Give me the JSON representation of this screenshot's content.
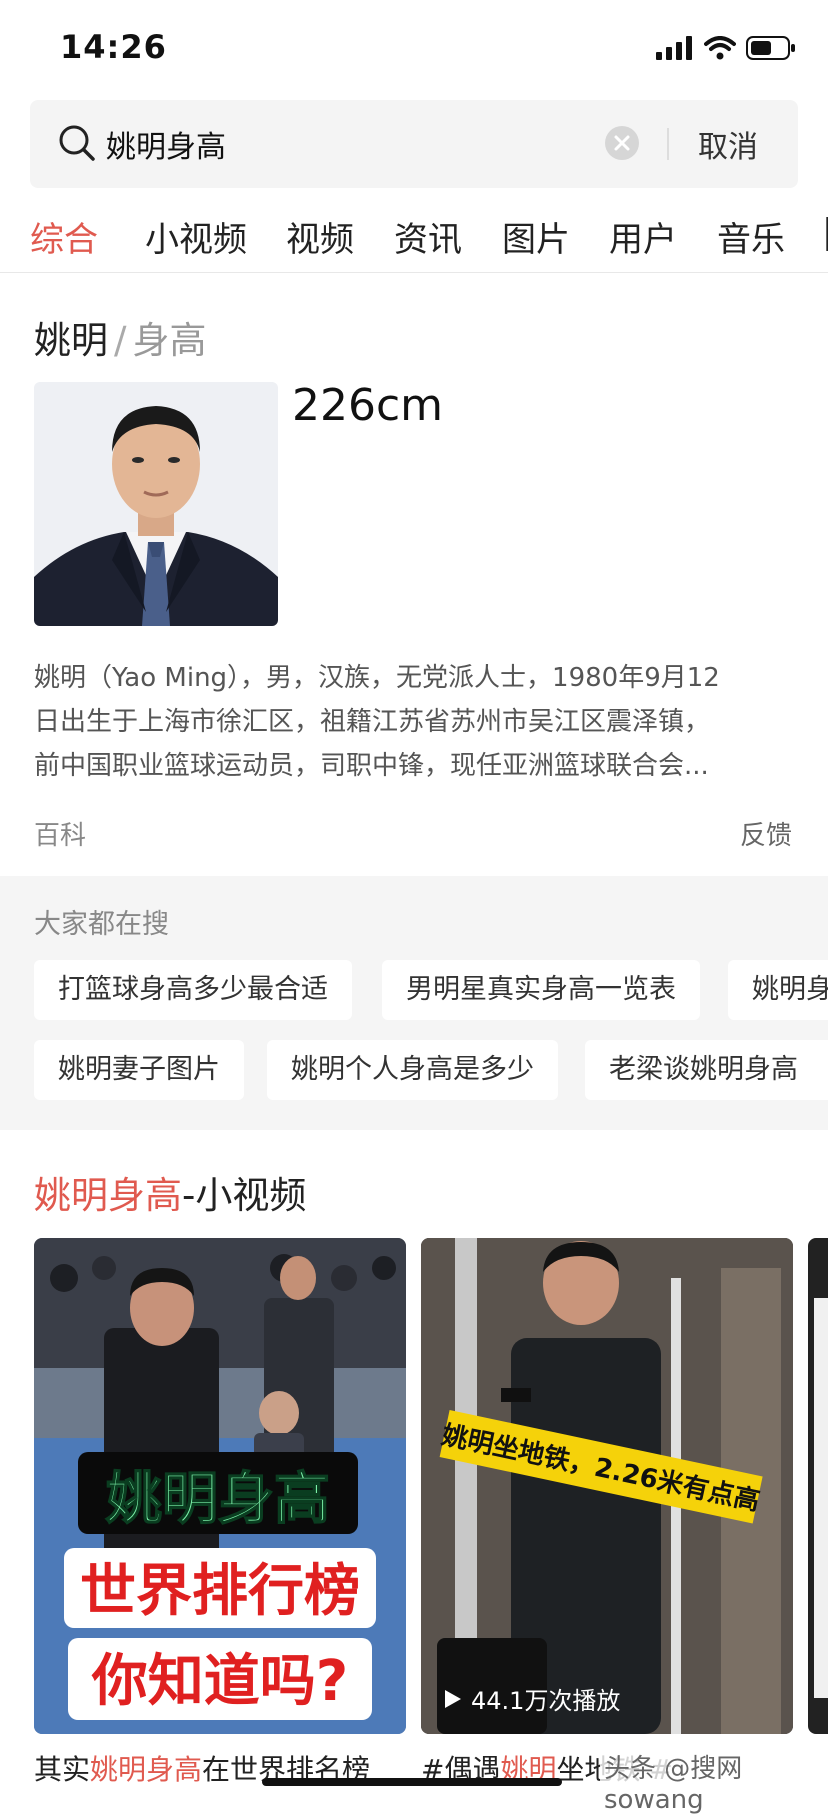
{
  "status_bar": {
    "time": "14:26"
  },
  "search": {
    "query": "姚明身高",
    "cancel_label": "取消"
  },
  "tabs": [
    {
      "label": "综合",
      "active": true
    },
    {
      "label": "小视频"
    },
    {
      "label": "视频"
    },
    {
      "label": "资讯"
    },
    {
      "label": "图片"
    },
    {
      "label": "用户"
    },
    {
      "label": "音乐"
    }
  ],
  "knowledge_card": {
    "entity": "姚明",
    "separator": "/",
    "attribute": "身高",
    "value": "226cm",
    "description_lines": [
      "姚明（Yao Ming），男，汉族，无党派人士，1980年9月12",
      "日出生于上海市徐汇区，祖籍江苏省苏州市吴江区震泽镇，",
      "前中国职业篮球运动员，司职中锋，现任亚洲篮球联合会..."
    ],
    "source": "百科",
    "feedback_label": "反馈"
  },
  "related_searches": {
    "title": "大家都在搜",
    "chips": [
      "打篮球身高多少最合适",
      "男明星真实身高一览表",
      "姚明身",
      "姚明妻子图片",
      "姚明个人身高是多少",
      "老梁谈姚明身高"
    ]
  },
  "video_section": {
    "title_highlight": "姚明身高",
    "title_rest": "-小视频",
    "cards": [
      {
        "overlay_line1": "姚明身高",
        "overlay_line2": "世界排行榜",
        "overlay_line3": "你知道吗?",
        "caption_pre": "其实",
        "caption_hl": "姚明身高",
        "caption_post": "在世界排名榜"
      },
      {
        "banner": "姚明坐地铁，2.26米有点高",
        "play_count": "44.1万次播放",
        "caption_pre": "#偶遇",
        "caption_hl": "姚明",
        "caption_post": "坐地铁 #"
      }
    ]
  },
  "watermark": "头条 @搜网sowang",
  "colors": {
    "accent": "#e05a4f"
  }
}
